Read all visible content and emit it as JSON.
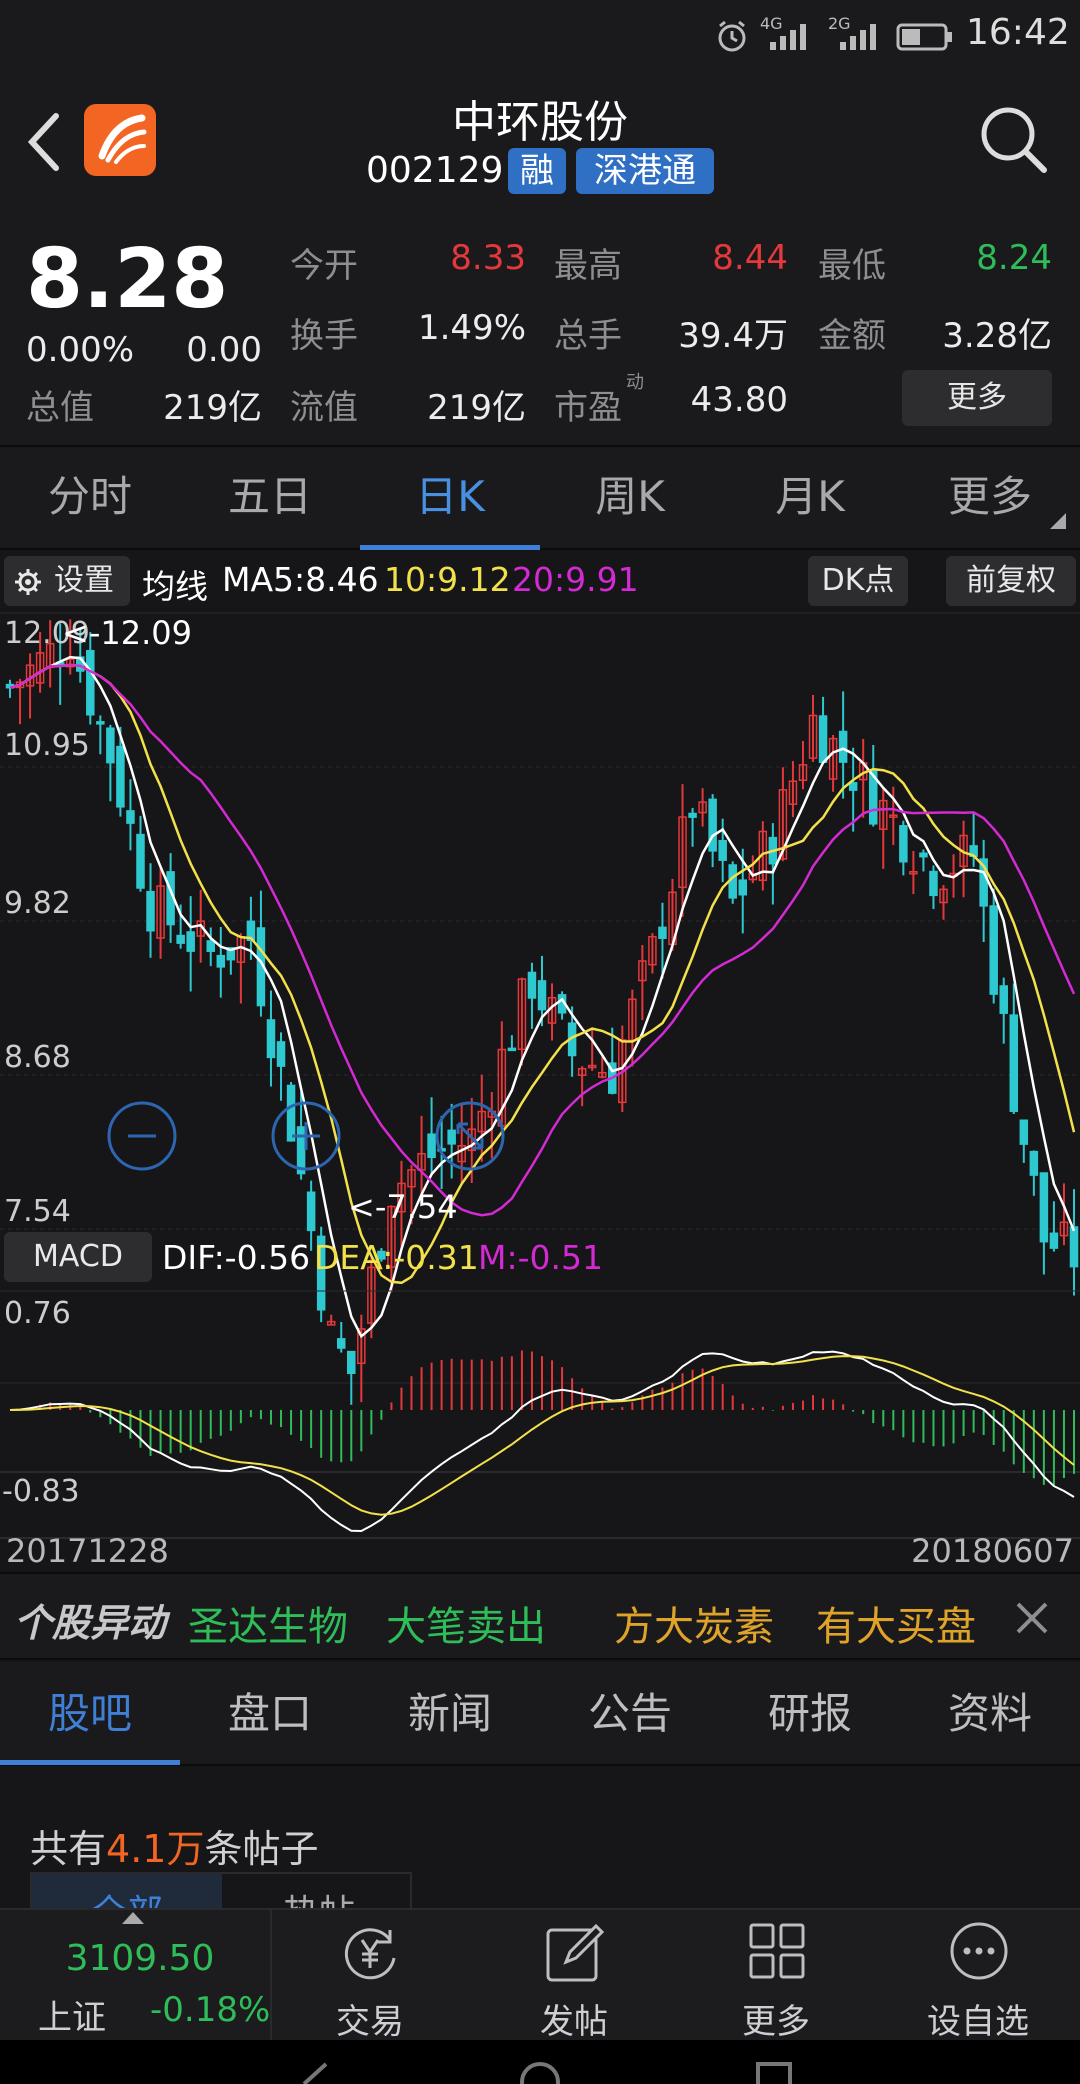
{
  "status_bar": {
    "network_1": "4G",
    "network_2": "2G",
    "time": "16:42"
  },
  "header": {
    "stock_name": "中环股份",
    "stock_code": "002129",
    "badge_margin": "融",
    "badge_connect": "深港通"
  },
  "quote": {
    "price": "8.28",
    "change_pct": "0.00%",
    "change": "0.00",
    "rows": [
      [
        {
          "label": "今开",
          "value": "8.33",
          "color": "red"
        },
        {
          "label": "最高",
          "value": "8.44",
          "color": "red"
        },
        {
          "label": "最低",
          "value": "8.24",
          "color": "green"
        }
      ],
      [
        {
          "label": "换手",
          "value": "1.49%",
          "color": "white"
        },
        {
          "label": "总手",
          "value": "39.4万",
          "color": "white"
        },
        {
          "label": "金额",
          "value": "3.28亿",
          "color": "white"
        }
      ]
    ],
    "market_cap_label": "总值",
    "market_cap": "219亿",
    "float_cap_label": "流值",
    "float_cap": "219亿",
    "pe_label": "市盈",
    "pe_superscript": "动",
    "pe": "43.80",
    "more_button": "更多"
  },
  "period_tabs": [
    "分时",
    "五日",
    "日K",
    "周K",
    "月K",
    "更多"
  ],
  "chart_toolbar": {
    "settings": "设置",
    "ma_title": "均线",
    "ma5": "MA5:8.46",
    "ma10": "10:9.12",
    "ma20": "20:9.91",
    "dk_button": "DK点",
    "adjust_button": "前复权"
  },
  "kline": {
    "y_labels": [
      "12.09",
      "10.95",
      "9.82",
      "8.68",
      "7.54"
    ],
    "high_marker": "<-12.09",
    "low_marker": "<-7.54",
    "zoom_out": "zoom-out-icon",
    "zoom_in": "zoom-in-icon",
    "fullscreen": "expand-icon"
  },
  "macd": {
    "button": "MACD",
    "dif": "DIF:-0.56",
    "dea": "DEA:-0.31",
    "m": "M:-0.51",
    "y_top": "0.76",
    "y_bottom": "-0.83",
    "date_start": "20171228",
    "date_end": "20180607"
  },
  "news_ticker": {
    "title": "个股异动",
    "items": [
      {
        "text": "圣达生物",
        "color": "green"
      },
      {
        "text": "大笔卖出",
        "color": "green"
      },
      {
        "text": "方大炭素",
        "color": "orange"
      },
      {
        "text": "有大买盘",
        "color": "orange"
      }
    ]
  },
  "bottom_tabs": [
    "股吧",
    "盘口",
    "新闻",
    "公告",
    "研报",
    "资料"
  ],
  "posts": {
    "prefix": "共有",
    "count": "4.1万",
    "suffix": "条帖子",
    "filter_all": "全部",
    "filter_hot": "热帖"
  },
  "bottom_bar": {
    "index_value": "3109.50",
    "index_name": "上证",
    "index_change": "-0.18%",
    "actions": [
      "交易",
      "发帖",
      "更多",
      "设自选"
    ]
  },
  "colors": {
    "up": "#e5383b",
    "down": "#2ec9d0",
    "ma5": "#ffffff",
    "ma10": "#f2e14b",
    "ma20": "#d32ad3",
    "accent": "#3f7fd6"
  }
}
